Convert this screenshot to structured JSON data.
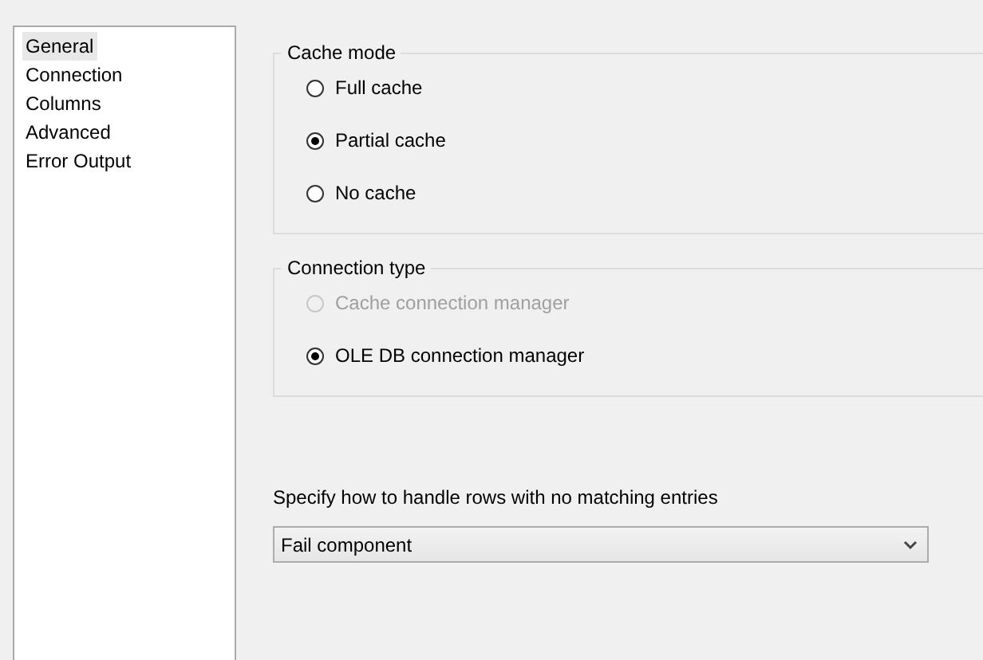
{
  "sidebar": {
    "items": [
      {
        "label": "General",
        "selected": true
      },
      {
        "label": "Connection",
        "selected": false
      },
      {
        "label": "Columns",
        "selected": false
      },
      {
        "label": "Advanced",
        "selected": false
      },
      {
        "label": "Error Output",
        "selected": false
      }
    ]
  },
  "groups": [
    {
      "title": "Cache mode",
      "options": [
        {
          "label": "Full cache",
          "selected": false,
          "disabled": false
        },
        {
          "label": "Partial cache",
          "selected": true,
          "disabled": false
        },
        {
          "label": "No cache",
          "selected": false,
          "disabled": false
        }
      ]
    },
    {
      "title": "Connection type",
      "options": [
        {
          "label": "Cache connection manager",
          "selected": false,
          "disabled": true
        },
        {
          "label": "OLE DB connection manager",
          "selected": true,
          "disabled": false
        }
      ]
    }
  ],
  "no_match": {
    "label": "Specify how to handle rows with no matching entries",
    "value": "Fail component"
  }
}
